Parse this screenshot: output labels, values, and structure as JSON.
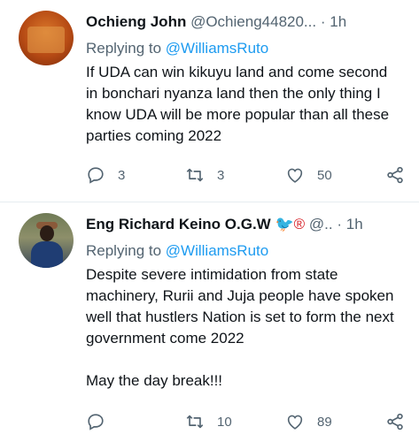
{
  "tweets": [
    {
      "name": "Ochieng John",
      "handle": "@Ochieng44820...",
      "dot": "·",
      "time": "1h",
      "replying_prefix": "Replying to ",
      "replying_to": "@WilliamsRuto",
      "text": "If UDA can win kikuyu land and come second in bonchari nyanza land then the only thing I know UDA will be more popular than all these parties coming 2022",
      "replies": "3",
      "retweets": "3",
      "likes": "50"
    },
    {
      "name": "Eng Richard Keino O.G.W",
      "name_emoji": "🐦®",
      "handle": "@..",
      "dot": "·",
      "time": "1h",
      "replying_prefix": "Replying to ",
      "replying_to": "@WilliamsRuto",
      "text": "Despite severe intimidation from state machinery, Rurii and Juja people have spoken well that hustlers Nation is set to form the next government come 2022\n\nMay the day break!!!",
      "replies": "",
      "retweets": "10",
      "likes": "89"
    }
  ],
  "icons": {
    "reply": "reply-icon",
    "retweet": "retweet-icon",
    "like": "heart-icon",
    "share": "share-icon"
  },
  "colors": {
    "link": "#1d9bf0",
    "muted": "#536471",
    "text": "#0f1419",
    "divider": "#e6ecf0"
  }
}
